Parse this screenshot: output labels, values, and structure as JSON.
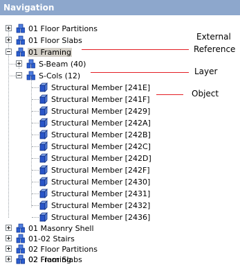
{
  "panel": {
    "title": "Navigation"
  },
  "tree": [
    {
      "label": "01 Floor Partitions",
      "icon": "external-reference-icon",
      "expander": "plus"
    },
    {
      "label": "01 Floor Slabs",
      "icon": "external-reference-icon",
      "expander": "plus"
    },
    {
      "label": "01 Framing",
      "icon": "external-reference-icon",
      "expander": "minus",
      "selected": true
    },
    {
      "label": "S-Beam (40)",
      "icon": "external-reference-icon",
      "expander": "plus"
    },
    {
      "label": "S-Cols (12)",
      "icon": "external-reference-icon",
      "expander": "minus"
    },
    {
      "label": "Structural Member [241E]",
      "icon": "cube-icon"
    },
    {
      "label": "Structural Member [241F]",
      "icon": "cube-icon"
    },
    {
      "label": "Structural Member [2429]",
      "icon": "cube-icon"
    },
    {
      "label": "Structural Member [242A]",
      "icon": "cube-icon"
    },
    {
      "label": "Structural Member [242B]",
      "icon": "cube-icon"
    },
    {
      "label": "Structural Member [242C]",
      "icon": "cube-icon"
    },
    {
      "label": "Structural Member [242D]",
      "icon": "cube-icon"
    },
    {
      "label": "Structural Member [242F]",
      "icon": "cube-icon"
    },
    {
      "label": "Structural Member [2430]",
      "icon": "cube-icon"
    },
    {
      "label": "Structural Member [2431]",
      "icon": "cube-icon"
    },
    {
      "label": "Structural Member [2432]",
      "icon": "cube-icon"
    },
    {
      "label": "Structural Member [2436]",
      "icon": "cube-icon"
    },
    {
      "label": "01 Masonry Shell",
      "icon": "external-reference-icon",
      "expander": "plus"
    },
    {
      "label": "01-02 Stairs",
      "icon": "external-reference-icon",
      "expander": "plus"
    },
    {
      "label": "02 Floor Partitions",
      "icon": "external-reference-icon",
      "expander": "plus"
    },
    {
      "label": "02 Floor Slabs",
      "icon": "external-reference-icon",
      "expander": "plus"
    },
    {
      "label": "02 Framing",
      "icon": "external-reference-icon",
      "expander": "plus"
    }
  ],
  "annotations": {
    "external_reference": [
      "External",
      "Reference"
    ],
    "layer": "Layer",
    "object": "Object"
  },
  "colors": {
    "header": "#8da7cc",
    "leader": "#e31e24",
    "icon_blue": "#1f4fbf"
  }
}
